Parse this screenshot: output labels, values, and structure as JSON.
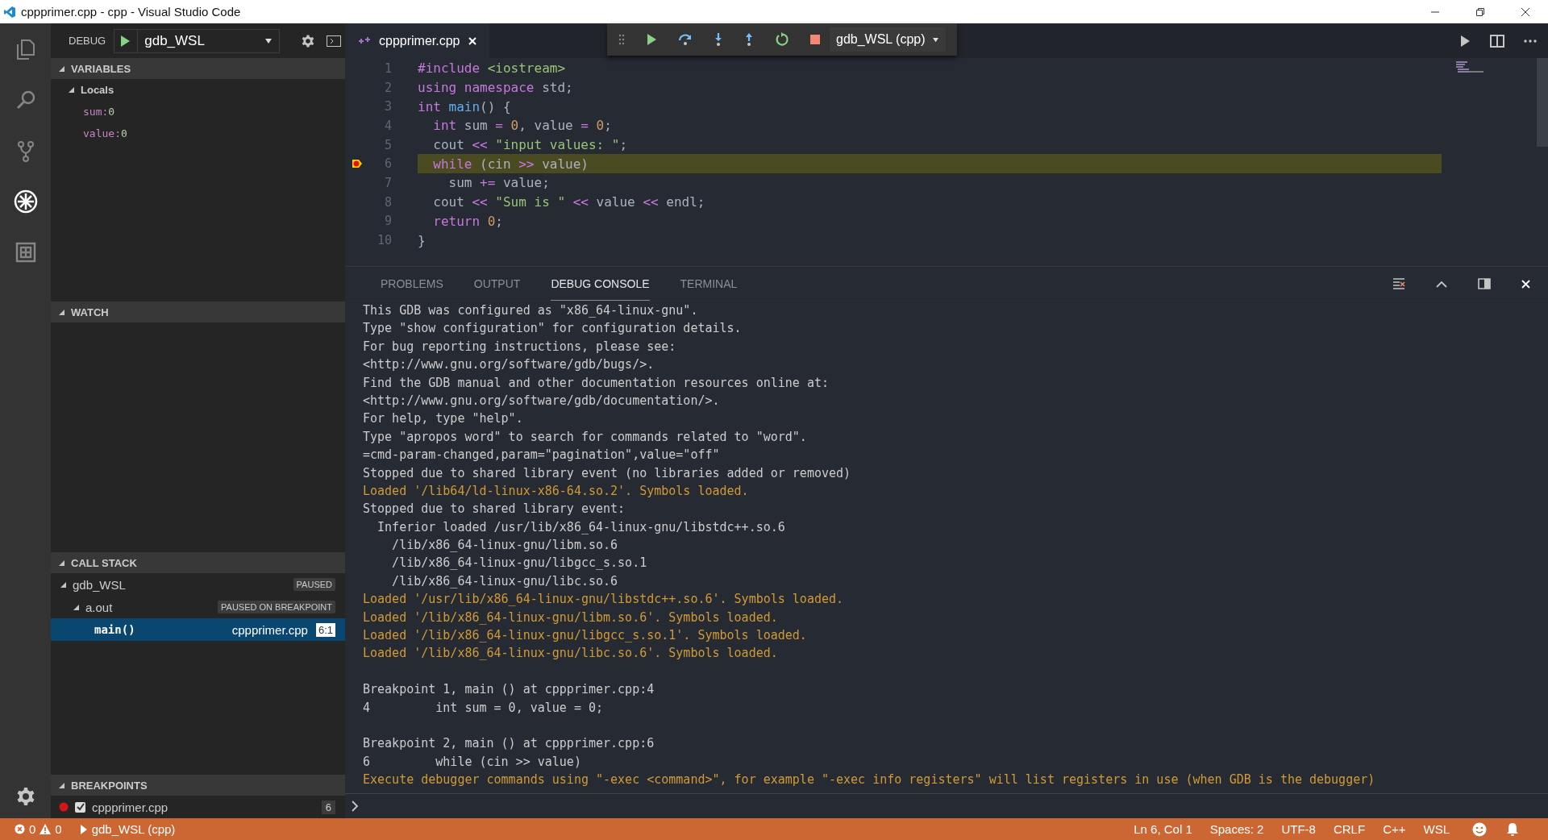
{
  "window": {
    "title": "cppprimer.cpp - cpp - Visual Studio Code"
  },
  "activity_bar": [
    {
      "kind": "files",
      "selected": false
    },
    {
      "kind": "search",
      "selected": false
    },
    {
      "kind": "scm",
      "selected": false
    },
    {
      "kind": "debug",
      "selected": true
    },
    {
      "kind": "extensions",
      "selected": false
    }
  ],
  "debug_header": {
    "label": "DEBUG",
    "configuration": "gdb_WSL"
  },
  "variables": {
    "title": "VARIABLES",
    "expanded": true,
    "scopes": [
      {
        "name": "Locals",
        "expanded": true,
        "vars": [
          {
            "name": "sum:",
            "value": "0"
          },
          {
            "name": "value:",
            "value": "0"
          }
        ]
      }
    ]
  },
  "watch": {
    "title": "WATCH",
    "expanded": true
  },
  "call_stack": {
    "title": "CALL STACK",
    "expanded": true,
    "sessions": [
      {
        "name": "gdb_WSL",
        "status": "PAUSED",
        "expanded": true,
        "threads": [
          {
            "name": "a.out",
            "status": "PAUSED ON BREAKPOINT",
            "expanded": true,
            "frames": [
              {
                "name": "main()",
                "file": "cppprimer.cpp",
                "position": "6:1",
                "selected": true
              }
            ]
          }
        ]
      }
    ]
  },
  "breakpoints": {
    "title": "BREAKPOINTS",
    "expanded": true,
    "items": [
      {
        "file": "cppprimer.cpp",
        "line": "6",
        "checked": true
      }
    ]
  },
  "editor_tabs": [
    {
      "label": "cppprimer.cpp",
      "selected": true
    }
  ],
  "debug_toolbar": {
    "configuration": "gdb_WSL (cpp)"
  },
  "code": [
    {
      "number": "1",
      "current": false,
      "breakpoint": false,
      "tokens": [
        {
          "text": "#include",
          "kind": "kw"
        },
        {
          "text": " <iostream>",
          "kind": "str"
        }
      ]
    },
    {
      "number": "2",
      "current": false,
      "breakpoint": false,
      "tokens": [
        {
          "text": "using",
          "kind": "kw"
        },
        {
          "text": " namespace",
          "kind": "kw"
        },
        {
          "text": " std;",
          "kind": "plain"
        }
      ]
    },
    {
      "number": "3",
      "current": false,
      "breakpoint": false,
      "tokens": [
        {
          "text": "int",
          "kind": "kw"
        },
        {
          "text": " main",
          "kind": "fn"
        },
        {
          "text": "() {",
          "kind": "plain"
        }
      ]
    },
    {
      "number": "4",
      "current": false,
      "breakpoint": false,
      "tokens": [
        {
          "text": "  int",
          "kind": "kw"
        },
        {
          "text": " sum ",
          "kind": "plain"
        },
        {
          "text": "=",
          "kind": "op"
        },
        {
          "text": " 0",
          "kind": "num"
        },
        {
          "text": ", value ",
          "kind": "plain"
        },
        {
          "text": "=",
          "kind": "op"
        },
        {
          "text": " 0",
          "kind": "num"
        },
        {
          "text": ";",
          "kind": "plain"
        }
      ]
    },
    {
      "number": "5",
      "current": false,
      "breakpoint": false,
      "tokens": [
        {
          "text": "  cout ",
          "kind": "plain"
        },
        {
          "text": "<<",
          "kind": "op"
        },
        {
          "text": " \"input values: \"",
          "kind": "str"
        },
        {
          "text": ";",
          "kind": "plain"
        }
      ]
    },
    {
      "number": "6",
      "current": true,
      "breakpoint": true,
      "tokens": [
        {
          "text": "  while",
          "kind": "kw"
        },
        {
          "text": " (cin ",
          "kind": "plain"
        },
        {
          "text": ">>",
          "kind": "op"
        },
        {
          "text": " value)",
          "kind": "plain"
        }
      ]
    },
    {
      "number": "7",
      "current": false,
      "breakpoint": false,
      "tokens": [
        {
          "text": "    sum ",
          "kind": "plain"
        },
        {
          "text": "+=",
          "kind": "op"
        },
        {
          "text": " value;",
          "kind": "plain"
        }
      ]
    },
    {
      "number": "8",
      "current": false,
      "breakpoint": false,
      "tokens": [
        {
          "text": "  cout ",
          "kind": "plain"
        },
        {
          "text": "<<",
          "kind": "op"
        },
        {
          "text": " \"Sum is \"",
          "kind": "str"
        },
        {
          "text": " <<",
          "kind": "op"
        },
        {
          "text": " value ",
          "kind": "plain"
        },
        {
          "text": "<<",
          "kind": "op"
        },
        {
          "text": " endl;",
          "kind": "plain"
        }
      ]
    },
    {
      "number": "9",
      "current": false,
      "breakpoint": false,
      "tokens": [
        {
          "text": "  return",
          "kind": "kw"
        },
        {
          "text": " 0",
          "kind": "num"
        },
        {
          "text": ";",
          "kind": "plain"
        }
      ]
    },
    {
      "number": "10",
      "current": false,
      "breakpoint": false,
      "tokens": [
        {
          "text": "}",
          "kind": "plain"
        }
      ]
    }
  ],
  "panel_tabs": [
    {
      "label": "PROBLEMS",
      "selected": false
    },
    {
      "label": "OUTPUT",
      "selected": false
    },
    {
      "label": "DEBUG CONSOLE",
      "selected": true
    },
    {
      "label": "TERMINAL",
      "selected": false
    }
  ],
  "console": [
    {
      "kind": "info",
      "text": "This GDB was configured as \"x86_64-linux-gnu\"."
    },
    {
      "kind": "info",
      "text": "Type \"show configuration\" for configuration details."
    },
    {
      "kind": "info",
      "text": "For bug reporting instructions, please see:"
    },
    {
      "kind": "info",
      "text": "<http://www.gnu.org/software/gdb/bugs/>."
    },
    {
      "kind": "info",
      "text": "Find the GDB manual and other documentation resources online at:"
    },
    {
      "kind": "info",
      "text": "<http://www.gnu.org/software/gdb/documentation/>."
    },
    {
      "kind": "info",
      "text": "For help, type \"help\"."
    },
    {
      "kind": "info",
      "text": "Type \"apropos word\" to search for commands related to \"word\"."
    },
    {
      "kind": "info",
      "text": "=cmd-param-changed,param=\"pagination\",value=\"off\""
    },
    {
      "kind": "info",
      "text": "Stopped due to shared library event (no libraries added or removed)"
    },
    {
      "kind": "loaded",
      "text": "Loaded '/lib64/ld-linux-x86-64.so.2'. Symbols loaded."
    },
    {
      "kind": "info",
      "text": "Stopped due to shared library event:"
    },
    {
      "kind": "info",
      "text": "  Inferior loaded /usr/lib/x86_64-linux-gnu/libstdc++.so.6"
    },
    {
      "kind": "info",
      "text": "    /lib/x86_64-linux-gnu/libm.so.6"
    },
    {
      "kind": "info",
      "text": "    /lib/x86_64-linux-gnu/libgcc_s.so.1"
    },
    {
      "kind": "info",
      "text": "    /lib/x86_64-linux-gnu/libc.so.6"
    },
    {
      "kind": "loaded",
      "text": "Loaded '/usr/lib/x86_64-linux-gnu/libstdc++.so.6'. Symbols loaded."
    },
    {
      "kind": "loaded",
      "text": "Loaded '/lib/x86_64-linux-gnu/libm.so.6'. Symbols loaded."
    },
    {
      "kind": "loaded",
      "text": "Loaded '/lib/x86_64-linux-gnu/libgcc_s.so.1'. Symbols loaded."
    },
    {
      "kind": "loaded",
      "text": "Loaded '/lib/x86_64-linux-gnu/libc.so.6'. Symbols loaded."
    },
    {
      "kind": "blank"
    },
    {
      "kind": "info",
      "text": "Breakpoint 1, main () at cppprimer.cpp:4"
    },
    {
      "kind": "info",
      "text": "4         int sum = 0, value = 0;"
    },
    {
      "kind": "blank"
    },
    {
      "kind": "info",
      "text": "Breakpoint 2, main () at cppprimer.cpp:6"
    },
    {
      "kind": "info",
      "text": "6         while (cin >> value)"
    },
    {
      "kind": "loaded",
      "text": "Execute debugger commands using \"-exec <command>\", for example \"-exec info registers\" will list registers in use (when GDB is the debugger)"
    }
  ],
  "status_bar": {
    "errors": "0",
    "warnings": "0",
    "session": "gdb_WSL (cpp)",
    "right": [
      "Ln 6, Col 1",
      "Spaces: 2",
      "UTF-8",
      "CRLF",
      "C++",
      "WSL"
    ]
  }
}
